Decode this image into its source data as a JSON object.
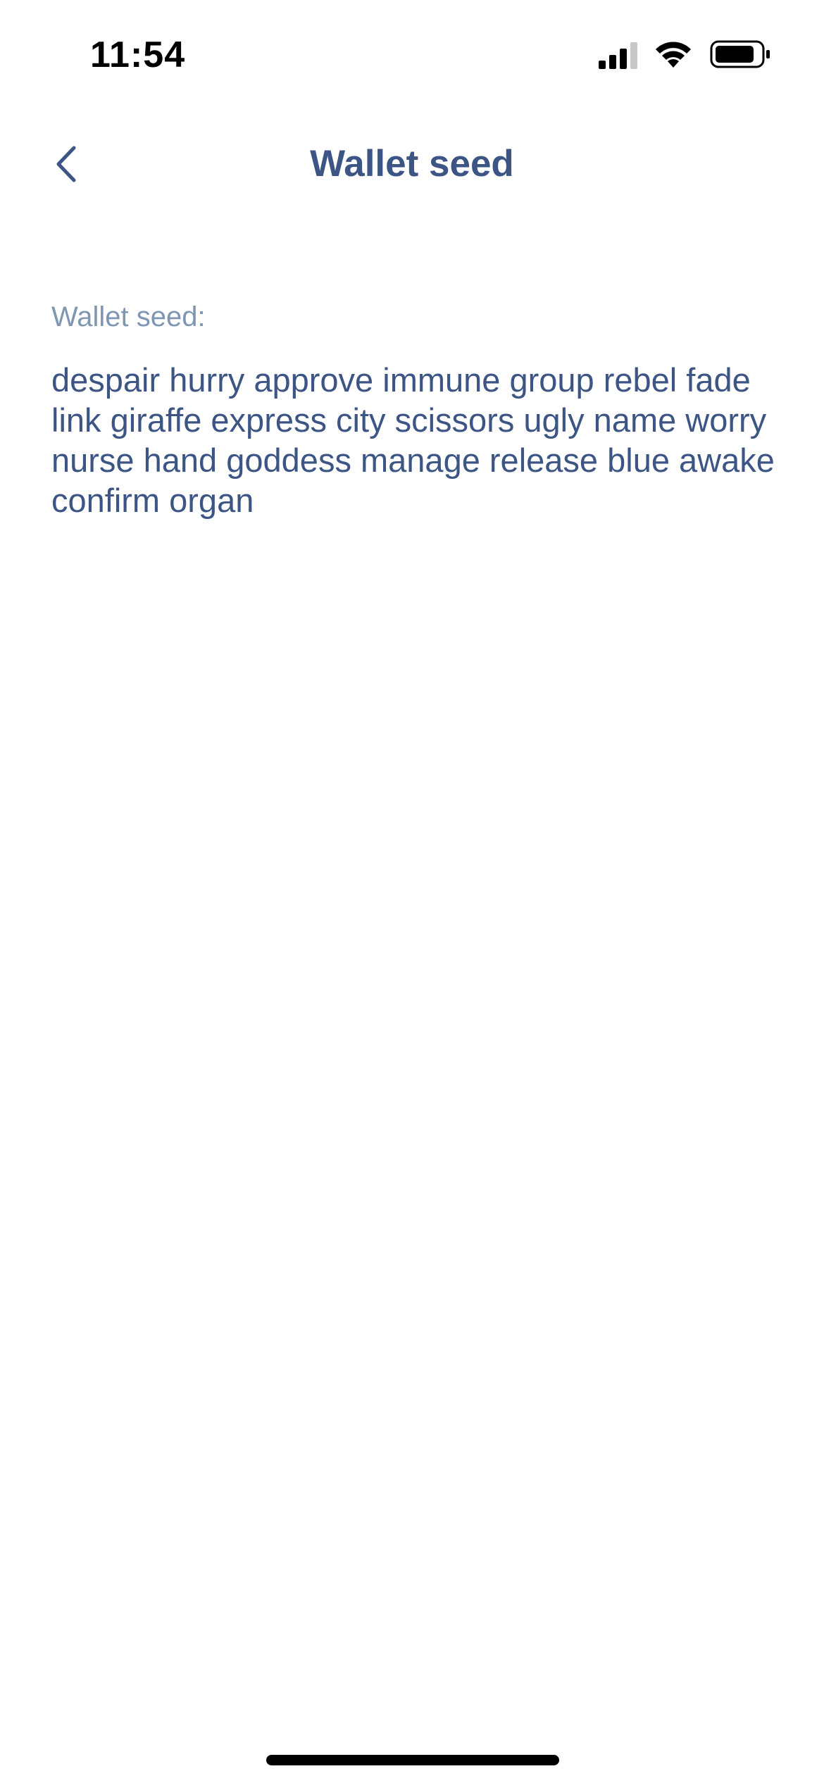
{
  "status_bar": {
    "time": "11:54",
    "icons": [
      "cellular-signal-icon",
      "wifi-icon",
      "battery-icon"
    ]
  },
  "nav": {
    "title": "Wallet seed",
    "back_icon": "chevron-left-icon"
  },
  "content": {
    "label": "Wallet seed:",
    "seed_phrase": "despair hurry approve immune group rebel fade link giraffe express city scissors ugly name worry nurse hand goddess manage release blue awake confirm organ"
  },
  "colors": {
    "title": "#3c5585",
    "label": "#7f96b3",
    "text": "#3c5585",
    "background": "#ffffff"
  }
}
